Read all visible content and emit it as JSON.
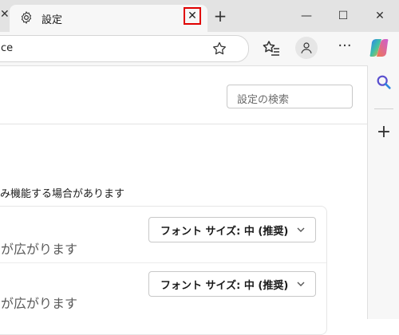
{
  "tabs": {
    "previous_tab_close": "✕",
    "active_title": "設定",
    "close_glyph": "✕",
    "new_tab_glyph": "+"
  },
  "window": {
    "minimize": "—",
    "maximize": "☐",
    "close": "✕"
  },
  "toolbar": {
    "address_text": "ce",
    "more_glyph": "···"
  },
  "content": {
    "search_placeholder": "設定の検索",
    "note_partial": "み機能する場合があります",
    "rows": [
      {
        "description_partial": "が広がります",
        "dropdown_value": "フォント サイズ: 中 (推奨)"
      },
      {
        "description_partial": "が広がります",
        "dropdown_value": "フォント サイズ: 中 (推奨)"
      }
    ]
  },
  "sidebar": {
    "add_glyph": "+"
  },
  "colors": {
    "highlight_border": "#e00000",
    "tabstrip_bg": "#e3e3e3",
    "toolbar_bg": "#f7f7f7"
  }
}
